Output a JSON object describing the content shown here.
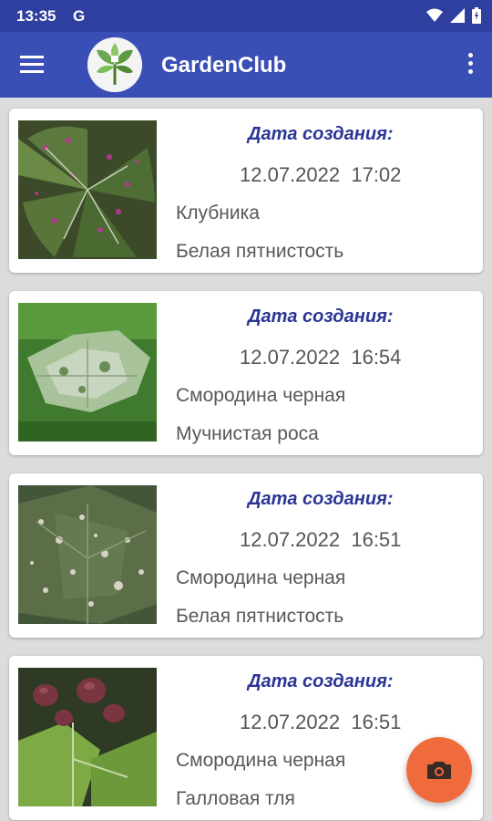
{
  "status_bar": {
    "time": "13:35",
    "google_icon": "G",
    "icons": [
      "wifi-icon",
      "signal-icon",
      "battery-icon"
    ]
  },
  "app_bar": {
    "title": "GardenClub",
    "menu_icon": "hamburger-menu-icon",
    "logo": "garden-club-logo",
    "overflow_icon": "more-vert-icon"
  },
  "records": [
    {
      "label": "Дата создания:",
      "date": "12.07.2022",
      "time": "17:02",
      "plant": "Клубника",
      "disease": "Белая пятнистость",
      "image": "strawberry-leaf-white-spot"
    },
    {
      "label": "Дата создания:",
      "date": "12.07.2022",
      "time": "16:54",
      "plant": "Смородина черная",
      "disease": "Мучнистая роса",
      "image": "currant-leaf-powdery-mildew"
    },
    {
      "label": "Дата создания:",
      "date": "12.07.2022",
      "time": "16:51",
      "plant": "Смородина черная",
      "disease": "Белая пятнистость",
      "image": "currant-leaf-white-spot"
    },
    {
      "label": "Дата создания:",
      "date": "12.07.2022",
      "time": "16:51",
      "plant": "Смородина черная",
      "disease": "Галловая тля",
      "image": "currant-leaf-gall-aphid"
    }
  ],
  "fab": {
    "icon": "camera-icon"
  },
  "colors": {
    "status_bar": "#2f3fa0",
    "app_bar": "#3a4fb6",
    "label_text": "#2a3595",
    "fab": "#f06b3c",
    "background": "#dcdcdc"
  }
}
